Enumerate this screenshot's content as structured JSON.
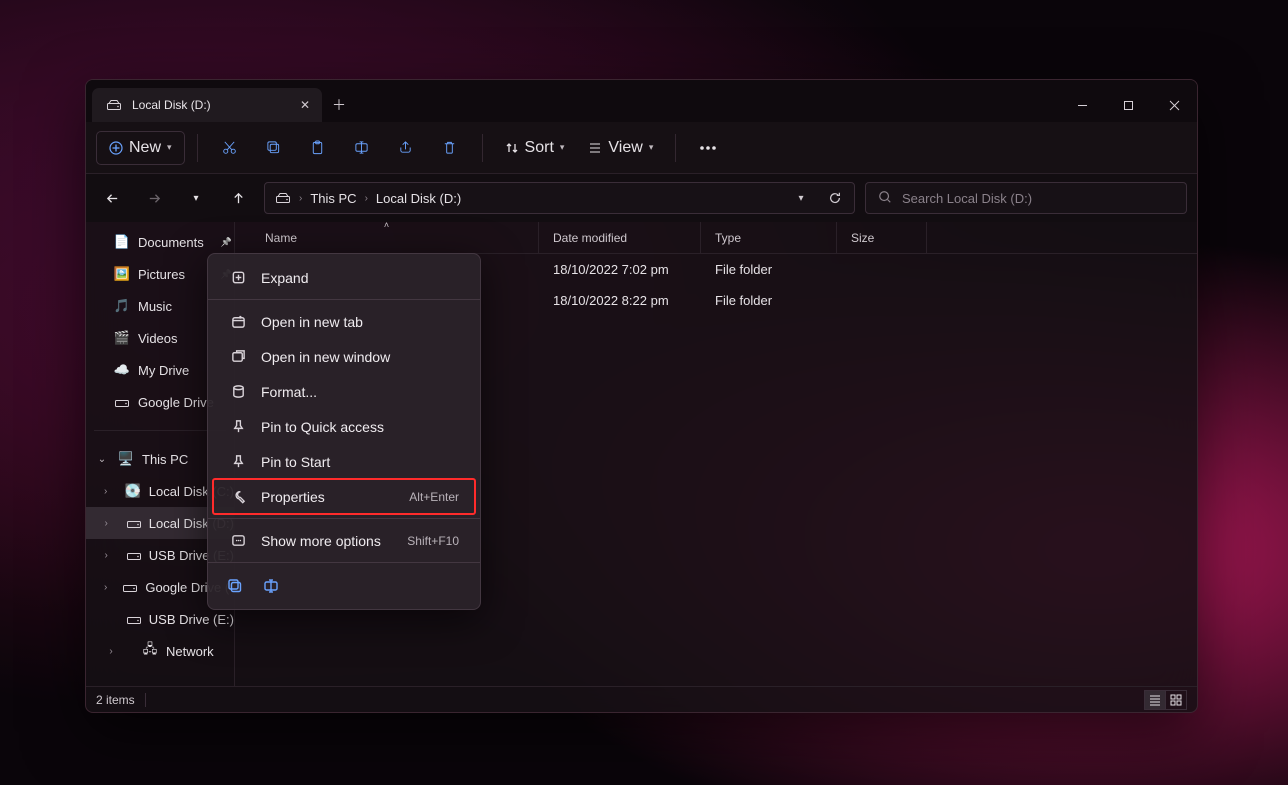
{
  "tab": {
    "title": "Local Disk (D:)"
  },
  "toolbar": {
    "new": "New",
    "sort": "Sort",
    "view": "View"
  },
  "breadcrumb": {
    "root": "This PC",
    "current": "Local Disk (D:)"
  },
  "search": {
    "placeholder": "Search Local Disk (D:)"
  },
  "sidebar": {
    "quick": [
      {
        "label": "Documents"
      },
      {
        "label": "Pictures"
      },
      {
        "label": "Music"
      },
      {
        "label": "Videos"
      },
      {
        "label": "My Drive"
      },
      {
        "label": "Google Drive"
      }
    ],
    "pc_label": "This PC",
    "tree": [
      {
        "label": "Local Disk (C:)"
      },
      {
        "label": "Local Disk (D:)"
      },
      {
        "label": "USB Drive (E:)"
      },
      {
        "label": "Google Drive (G:)"
      },
      {
        "label": "USB Drive (E:)"
      },
      {
        "label": "Network"
      }
    ]
  },
  "columns": {
    "name": "Name",
    "date": "Date modified",
    "type": "Type",
    "size": "Size"
  },
  "rows": [
    {
      "name": "",
      "date": "18/10/2022 7:02 pm",
      "type": "File folder",
      "size": ""
    },
    {
      "name": "",
      "date": "18/10/2022 8:22 pm",
      "type": "File folder",
      "size": ""
    }
  ],
  "context_menu": [
    {
      "icon": "expand",
      "label": "Expand",
      "shortcut": ""
    },
    {
      "sep": true
    },
    {
      "icon": "newtab",
      "label": "Open in new tab",
      "shortcut": ""
    },
    {
      "icon": "newwin",
      "label": "Open in new window",
      "shortcut": ""
    },
    {
      "icon": "format",
      "label": "Format...",
      "shortcut": ""
    },
    {
      "icon": "pin",
      "label": "Pin to Quick access",
      "shortcut": ""
    },
    {
      "icon": "pin",
      "label": "Pin to Start",
      "shortcut": ""
    },
    {
      "icon": "wrench",
      "label": "Properties",
      "shortcut": "Alt+Enter",
      "highlight": true
    },
    {
      "sep": true
    },
    {
      "icon": "more",
      "label": "Show more options",
      "shortcut": "Shift+F10"
    },
    {
      "sep": true
    }
  ],
  "status": {
    "items": "2 items"
  }
}
